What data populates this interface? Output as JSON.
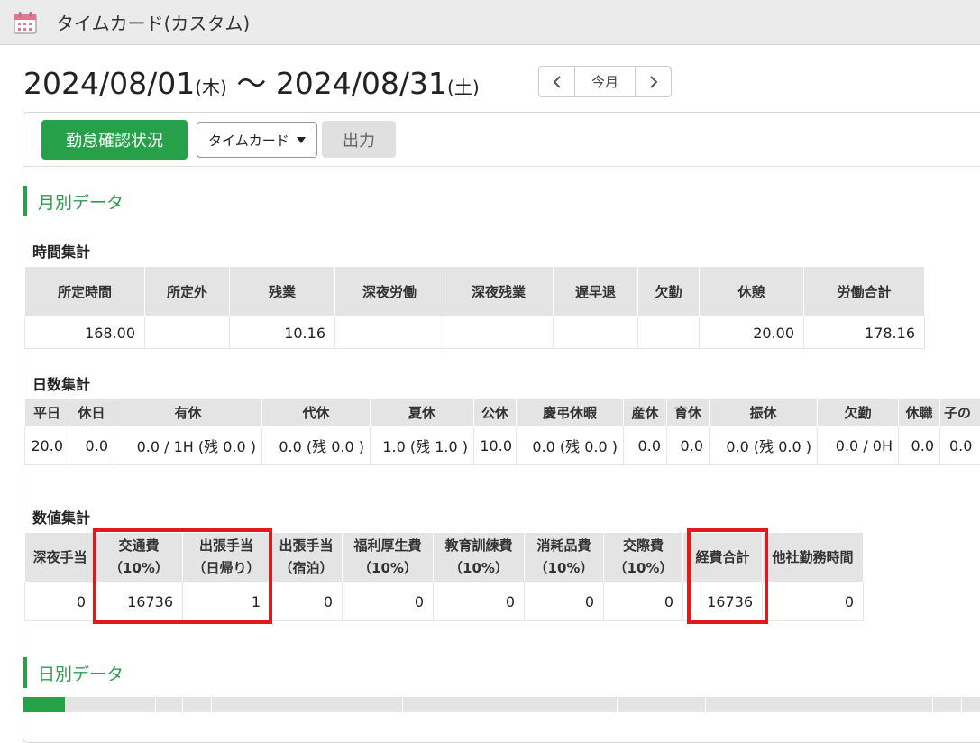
{
  "app": {
    "title": "タイムカード(カスタム)",
    "icon": "calendar-icon"
  },
  "range": {
    "start": "2024/08/01",
    "start_dow": "(木)",
    "sep": "〜",
    "end": "2024/08/31",
    "end_dow": "(土)"
  },
  "nav": {
    "prev": "‹",
    "today": "今月",
    "next": "›"
  },
  "toolbar": {
    "primary": "勤怠確認状況",
    "select_value": "タイムカード",
    "export": "出力"
  },
  "monthly": {
    "heading": "月別データ",
    "time_title": "時間集計",
    "time_headers": [
      "所定時間",
      "所定外",
      "残業",
      "深夜労働",
      "深夜残業",
      "遅早退",
      "欠勤",
      "休憩",
      "労働合計"
    ],
    "time_values": [
      "168.00",
      "",
      "10.16",
      "",
      "",
      "",
      "",
      "20.00",
      "178.16"
    ],
    "days_title": "日数集計",
    "days_headers": [
      "平日",
      "休日",
      "有休",
      "代休",
      "夏休",
      "公休",
      "慶弔休暇",
      "産休",
      "育休",
      "振休",
      "欠勤",
      "休職",
      "子の"
    ],
    "days_values": [
      "20.0",
      "0.0",
      "0.0 / 1H (残 0.0 )",
      "0.0 (残 0.0 )",
      "1.0 (残 1.0 )",
      "10.0",
      "0.0 (残 0.0 )",
      "0.0",
      "0.0",
      "0.0 (残 0.0 )",
      "0.0 / 0H",
      "0.0",
      "0.0"
    ],
    "num_title": "数値集計",
    "num_headers": [
      [
        "深夜手当",
        ""
      ],
      [
        "交通費",
        "（10%）"
      ],
      [
        "出張手当",
        "（日帰り）"
      ],
      [
        "出張手当",
        "（宿泊）"
      ],
      [
        "福利厚生費",
        "（10%）"
      ],
      [
        "教育訓練費",
        "（10%）"
      ],
      [
        "消耗品費",
        "（10%）"
      ],
      [
        "交際費",
        "（10%）"
      ],
      [
        "経費合計",
        ""
      ],
      [
        "他社勤務時間",
        ""
      ]
    ],
    "num_values": [
      "0",
      "16736",
      "1",
      "0",
      "0",
      "0",
      "0",
      "0",
      "16736",
      "0"
    ]
  },
  "daily": {
    "heading": "日別データ"
  },
  "colors": {
    "accent": "#27a04a",
    "highlight": "#e0191b"
  }
}
